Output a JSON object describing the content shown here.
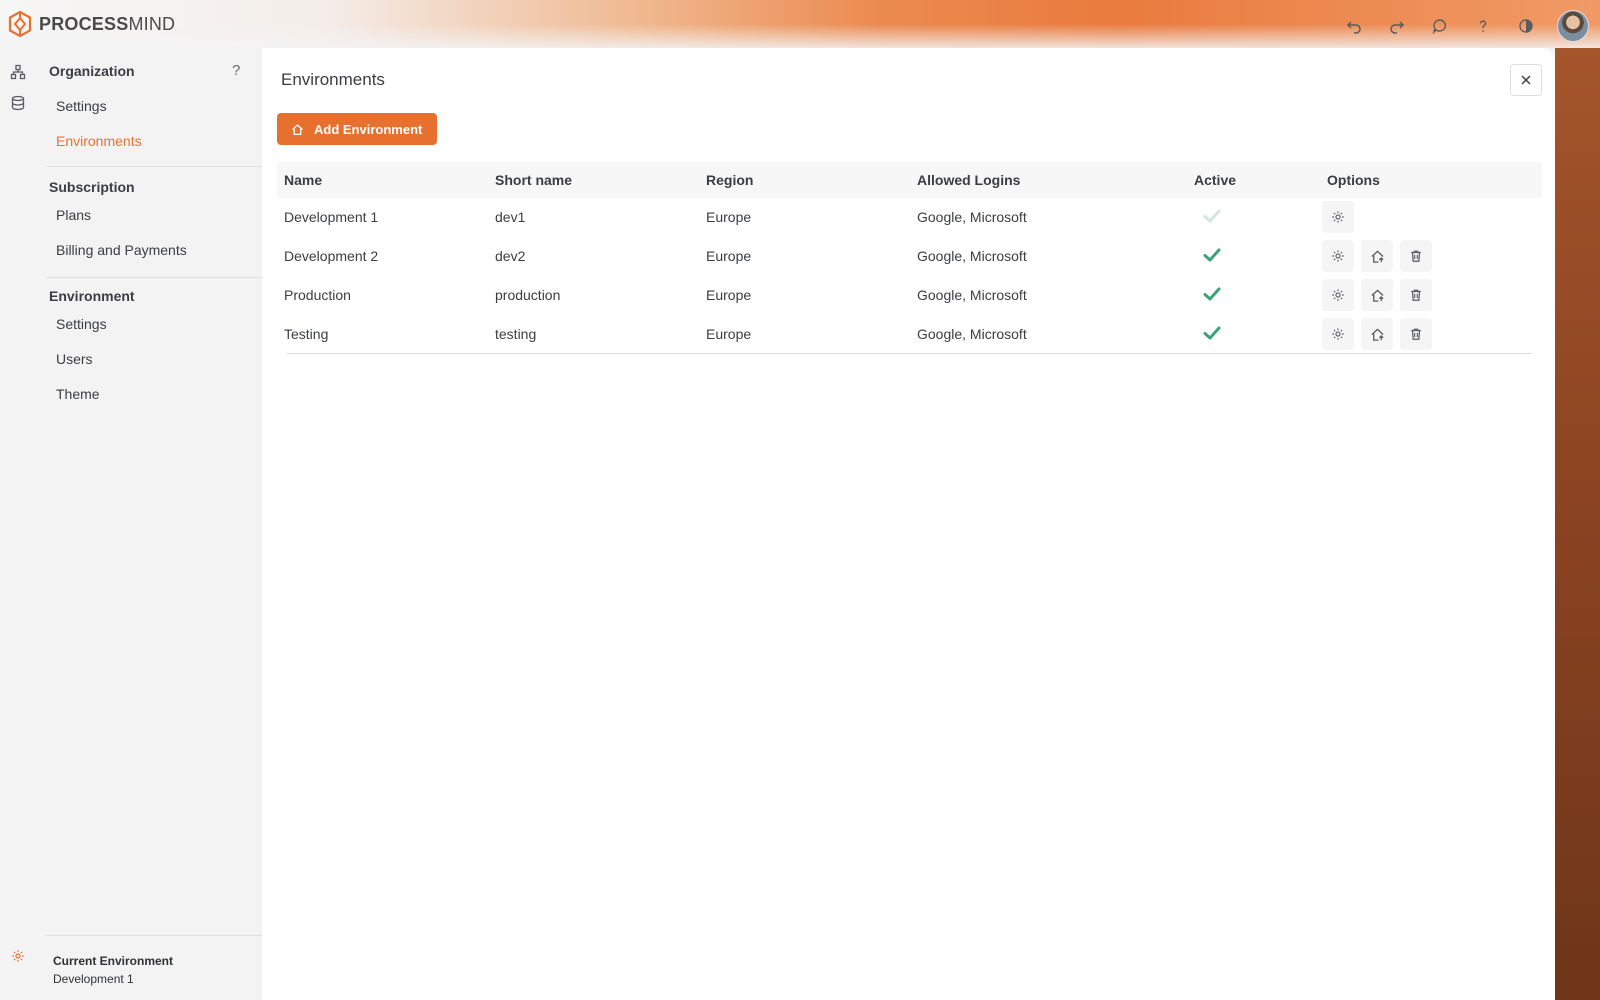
{
  "app": {
    "brand_bold": "PROCESS",
    "brand_light": "MIND"
  },
  "sidebar": {
    "help_label": "?",
    "sections": [
      {
        "title": "Organization",
        "items": [
          "Settings",
          "Environments"
        ]
      },
      {
        "title": "Subscription",
        "items": [
          "Plans",
          "Billing and Payments"
        ]
      },
      {
        "title": "Environment",
        "items": [
          "Settings",
          "Users",
          "Theme"
        ]
      }
    ],
    "active_item": "Environments",
    "current_environment_label": "Current Environment",
    "current_environment_value": "Development 1"
  },
  "panel": {
    "title": "Environments",
    "add_button_label": "Add Environment",
    "close_label": "×"
  },
  "table": {
    "headers": [
      "Name",
      "Short name",
      "Region",
      "Allowed Logins",
      "Active",
      "Options"
    ],
    "rows": [
      {
        "name": "Development 1",
        "short_name": "dev1",
        "region": "Europe",
        "logins": "Google, Microsoft",
        "active": "faded",
        "options": [
          "settings"
        ]
      },
      {
        "name": "Development 2",
        "short_name": "dev2",
        "region": "Europe",
        "logins": "Google, Microsoft",
        "active": "yes",
        "options": [
          "settings",
          "switch",
          "delete"
        ]
      },
      {
        "name": "Production",
        "short_name": "production",
        "region": "Europe",
        "logins": "Google, Microsoft",
        "active": "yes",
        "options": [
          "settings",
          "switch",
          "delete"
        ]
      },
      {
        "name": "Testing",
        "short_name": "testing",
        "region": "Europe",
        "logins": "Google, Microsoft",
        "active": "yes",
        "options": [
          "settings",
          "switch",
          "delete"
        ]
      }
    ]
  },
  "colors": {
    "accent": "#e8702f",
    "active_check": "#3aa37a",
    "faded_check": "#cfe8dc"
  },
  "icons": {
    "top_actions": [
      "undo-icon",
      "redo-icon",
      "chat-icon",
      "help-icon",
      "theme-icon"
    ],
    "rail": [
      "process-map-icon",
      "database-icon",
      "settings-gear-icon"
    ]
  }
}
